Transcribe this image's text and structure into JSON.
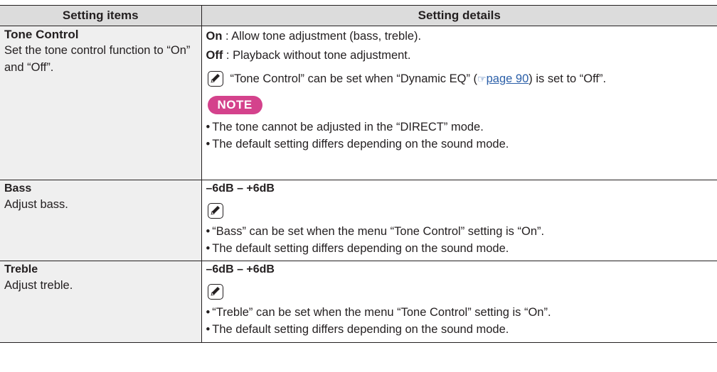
{
  "header": {
    "col1": "Setting items",
    "col2": "Setting details"
  },
  "rows": [
    {
      "title": "Tone Control",
      "description": "Set the tone control function to “On” and “Off”.",
      "options": [
        {
          "key": "On",
          "text": " : Allow tone adjustment (bass, treble)."
        },
        {
          "key": "Off",
          "text": " : Playback without tone adjustment."
        }
      ],
      "tip": {
        "before": "“Tone Control” can be set when “Dynamic EQ” (",
        "link": "page 90",
        "after": ") is set to “Off”."
      },
      "note_badge": "NOTE",
      "notes": [
        "The tone cannot be adjusted in the “DIRECT” mode.",
        "The default setting differs depending on the sound mode."
      ]
    },
    {
      "title": "Bass",
      "description": "Adjust bass.",
      "range": "–6dB – +6dB",
      "notes": [
        "“Bass” can be set when the menu “Tone Control” setting is “On”.",
        "The default setting differs depending on the sound mode."
      ]
    },
    {
      "title": "Treble",
      "description": "Adjust treble.",
      "range": "–6dB – +6dB",
      "notes": [
        "“Treble” can be set when the menu “Tone Control” setting is “On”.",
        "The default setting differs depending on the sound mode."
      ]
    }
  ],
  "icons": {
    "tip": "pencil-icon",
    "reference": "pointing-hand-icon"
  },
  "colors": {
    "header_bg": "#dcdcdc",
    "item_bg": "#efefef",
    "note_badge": "#d4428c",
    "link": "#2b5fa8"
  }
}
